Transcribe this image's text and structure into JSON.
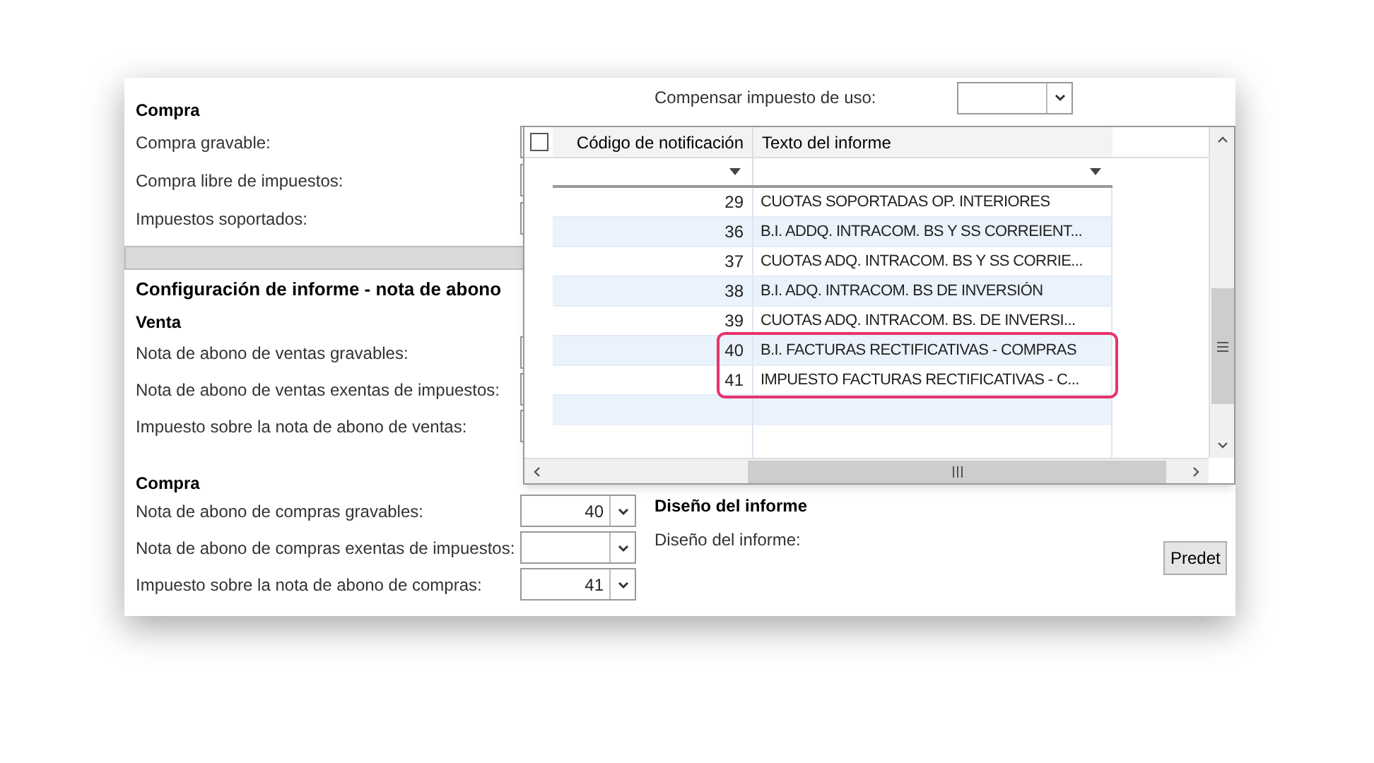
{
  "top_right": {
    "label": "Compensar impuesto de uso:"
  },
  "purchase": {
    "heading": "Compra",
    "fields": [
      {
        "label": "Compra gravable:"
      },
      {
        "label": "Compra libre de impuestos:"
      },
      {
        "label": "Impuestos soportados:"
      }
    ]
  },
  "credit_note": {
    "title": "Configuración de informe - nota de abono",
    "sales": {
      "heading": "Venta",
      "fields": [
        {
          "label": "Nota de abono de ventas gravables:"
        },
        {
          "label": "Nota de abono de ventas exentas de impuestos:"
        },
        {
          "label": "Impuesto sobre la nota de abono de ventas:"
        }
      ]
    },
    "purchases": {
      "heading": "Compra",
      "fields": [
        {
          "label": "Nota de abono de compras gravables:",
          "value": "40"
        },
        {
          "label": "Nota de abono de compras exentas de impuestos:"
        },
        {
          "label": "Impuesto sobre la nota de abono de compras:",
          "value": "41"
        }
      ]
    }
  },
  "report_design": {
    "heading": "Diseño del informe",
    "label": "Diseño del informe:",
    "button": "Predet"
  },
  "lookup": {
    "select_all_checked": false,
    "columns": [
      "Código de notificación",
      "Texto del informe"
    ],
    "rows": [
      {
        "code": "29",
        "text": "CUOTAS SOPORTADAS OP. INTERIORES",
        "highlighted": false
      },
      {
        "code": "36",
        "text": "B.I. ADDQ. INTRACOM. BS Y SS CORREIENT...",
        "highlighted": false
      },
      {
        "code": "37",
        "text": "CUOTAS ADQ. INTRACOM. BS Y SS CORRIE...",
        "highlighted": false
      },
      {
        "code": "38",
        "text": "B.I. ADQ. INTRACOM. BS DE INVERSIÓN",
        "highlighted": false
      },
      {
        "code": "39",
        "text": "CUOTAS ADQ. INTRACOM. BS. DE INVERSI...",
        "highlighted": false
      },
      {
        "code": "40",
        "text": "B.I. FACTURAS RECTIFICATIVAS - COMPRAS",
        "highlighted": true
      },
      {
        "code": "41",
        "text": "IMPUESTO FACTURAS RECTIFICATIVAS - C...",
        "highlighted": true
      }
    ]
  }
}
